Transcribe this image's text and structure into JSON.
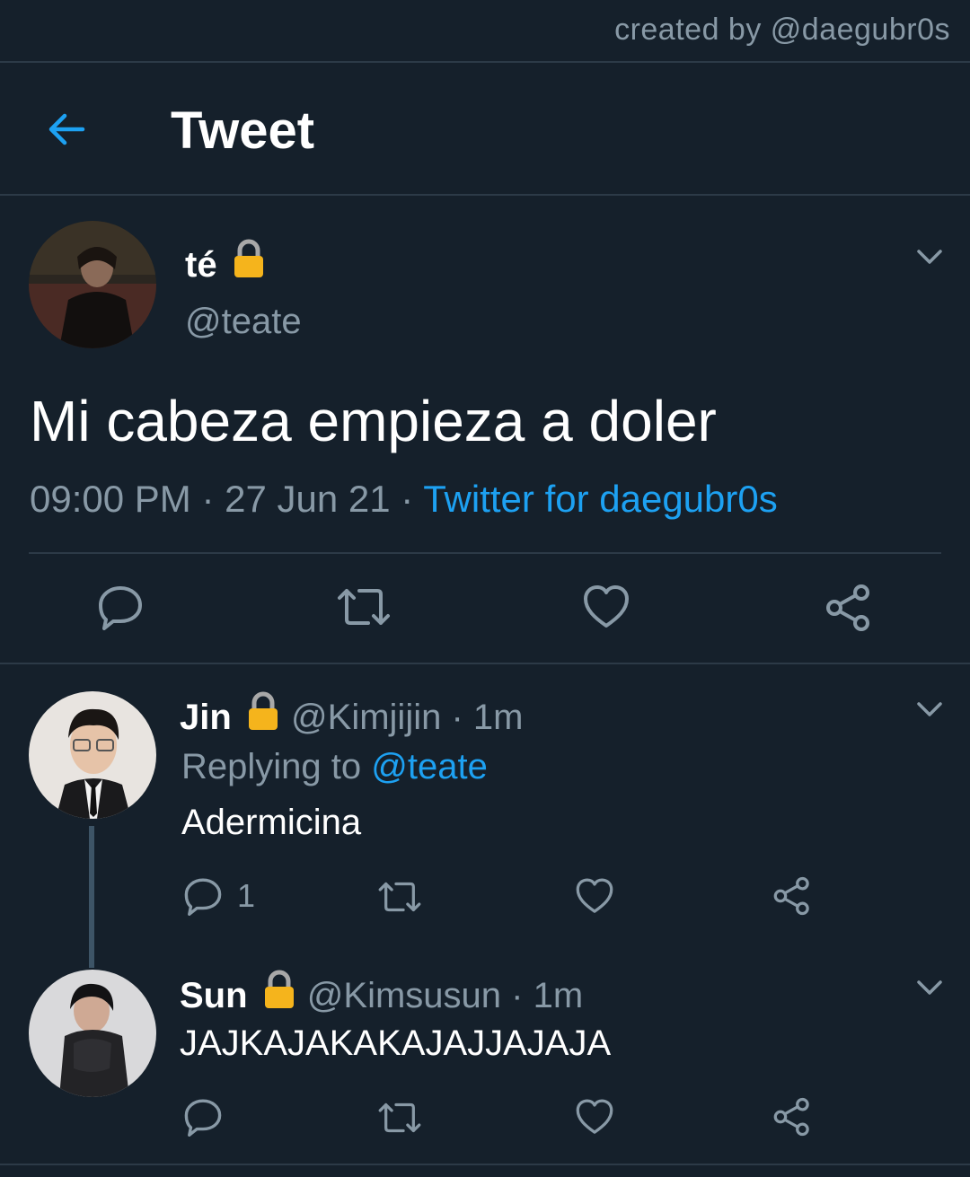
{
  "credit": "created by @daegubr0s",
  "header": {
    "title": "Tweet"
  },
  "tweet": {
    "display_name": "té",
    "handle": "@teate",
    "text": "Mi cabeza empieza a doler",
    "time": "09:00 PM",
    "date": "27 Jun 21",
    "source": "Twitter for daegubr0s",
    "separator": "·"
  },
  "replies": [
    {
      "display_name": "Jin",
      "handle": "@Kimjijin",
      "age": "· 1m",
      "replying_prefix": "Replying to",
      "replying_to": "@teate",
      "text": "Adermicina",
      "reply_count": "1"
    },
    {
      "display_name": "Sun",
      "handle": "@Kimsusun",
      "age": "· 1m",
      "text": "JAJKAJAKAKAJAJJAJAJA"
    }
  ],
  "colors": {
    "background": "#15202b",
    "accent": "#1da1f2",
    "muted": "#8899a6",
    "divider": "#2c3a47"
  },
  "icons": [
    "back-arrow-icon",
    "lock-icon",
    "chevron-down-icon",
    "reply-icon",
    "retweet-icon",
    "like-icon",
    "share-icon"
  ]
}
